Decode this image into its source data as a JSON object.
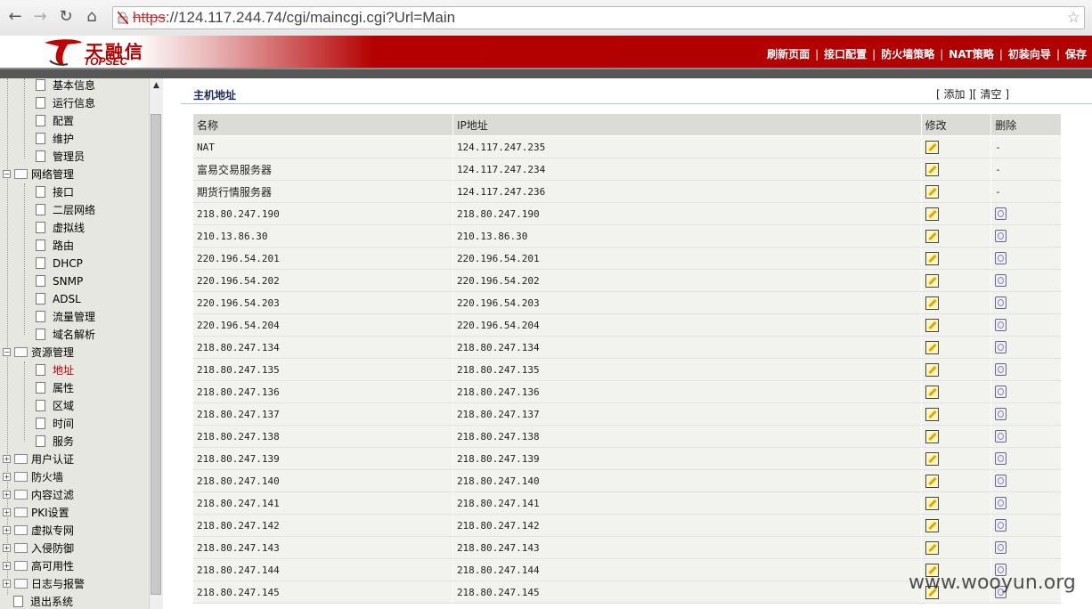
{
  "browser": {
    "url_scheme": "https",
    "url_host": "://124.117.244.74",
    "url_path": "/cgi/maincgi.cgi?Url=Main"
  },
  "header": {
    "logo_cn": "天融信",
    "logo_en": "TOPSEC",
    "menu": [
      "刷新页面",
      "接口配置",
      "防火墙策略",
      "NAT策略",
      "初装向导",
      "保存"
    ]
  },
  "sidebar": {
    "items": [
      {
        "label": "基本信息",
        "level": 2
      },
      {
        "label": "运行信息",
        "level": 2
      },
      {
        "label": "配置",
        "level": 2
      },
      {
        "label": "维护",
        "level": 2
      },
      {
        "label": "管理员",
        "level": 2
      },
      {
        "label": "网络管理",
        "level": 1,
        "state": "expanded"
      },
      {
        "label": "接口",
        "level": 2
      },
      {
        "label": "二层网络",
        "level": 2
      },
      {
        "label": "虚拟线",
        "level": 2
      },
      {
        "label": "路由",
        "level": 2
      },
      {
        "label": "DHCP",
        "level": 2
      },
      {
        "label": "SNMP",
        "level": 2
      },
      {
        "label": "ADSL",
        "level": 2
      },
      {
        "label": "流量管理",
        "level": 2
      },
      {
        "label": "域名解析",
        "level": 2
      },
      {
        "label": "资源管理",
        "level": 1,
        "state": "expanded"
      },
      {
        "label": "地址",
        "level": 2,
        "active": true
      },
      {
        "label": "属性",
        "level": 2
      },
      {
        "label": "区域",
        "level": 2
      },
      {
        "label": "时间",
        "level": 2
      },
      {
        "label": "服务",
        "level": 2
      },
      {
        "label": "用户认证",
        "level": 1,
        "state": "collapsed"
      },
      {
        "label": "防火墙",
        "level": 1,
        "state": "collapsed"
      },
      {
        "label": "内容过滤",
        "level": 1,
        "state": "collapsed"
      },
      {
        "label": "PKI设置",
        "level": 1,
        "state": "collapsed"
      },
      {
        "label": "虚拟专网",
        "level": 1,
        "state": "collapsed"
      },
      {
        "label": "入侵防御",
        "level": 1,
        "state": "collapsed"
      },
      {
        "label": "高可用性",
        "level": 1,
        "state": "collapsed"
      },
      {
        "label": "日志与报警",
        "level": 1,
        "state": "collapsed"
      },
      {
        "label": "退出系统",
        "level": 1,
        "state": "leaf"
      }
    ]
  },
  "main": {
    "title": "主机地址",
    "action_open": "[ ",
    "action_add": "添加",
    "action_mid": " ][ ",
    "action_clear": "清空",
    "action_close": " ]",
    "columns": [
      "名称",
      "IP地址",
      "修改",
      "删除"
    ],
    "rows": [
      {
        "name": "NAT",
        "ip": "124.117.247.235",
        "delete": "-"
      },
      {
        "name": "富易交易服务器",
        "ip": "124.117.247.234",
        "delete": "-"
      },
      {
        "name": "期货行情服务器",
        "ip": "124.117.247.236",
        "delete": "-"
      },
      {
        "name": "218.80.247.190",
        "ip": "218.80.247.190",
        "delete": "icon"
      },
      {
        "name": "210.13.86.30",
        "ip": "210.13.86.30",
        "delete": "icon"
      },
      {
        "name": "220.196.54.201",
        "ip": "220.196.54.201",
        "delete": "icon"
      },
      {
        "name": "220.196.54.202",
        "ip": "220.196.54.202",
        "delete": "icon"
      },
      {
        "name": "220.196.54.203",
        "ip": "220.196.54.203",
        "delete": "icon"
      },
      {
        "name": "220.196.54.204",
        "ip": "220.196.54.204",
        "delete": "icon"
      },
      {
        "name": "218.80.247.134",
        "ip": "218.80.247.134",
        "delete": "icon"
      },
      {
        "name": "218.80.247.135",
        "ip": "218.80.247.135",
        "delete": "icon"
      },
      {
        "name": "218.80.247.136",
        "ip": "218.80.247.136",
        "delete": "icon"
      },
      {
        "name": "218.80.247.137",
        "ip": "218.80.247.137",
        "delete": "icon"
      },
      {
        "name": "218.80.247.138",
        "ip": "218.80.247.138",
        "delete": "icon"
      },
      {
        "name": "218.80.247.139",
        "ip": "218.80.247.139",
        "delete": "icon"
      },
      {
        "name": "218.80.247.140",
        "ip": "218.80.247.140",
        "delete": "icon"
      },
      {
        "name": "218.80.247.141",
        "ip": "218.80.247.141",
        "delete": "icon"
      },
      {
        "name": "218.80.247.142",
        "ip": "218.80.247.142",
        "delete": "icon"
      },
      {
        "name": "218.80.247.143",
        "ip": "218.80.247.143",
        "delete": "icon"
      },
      {
        "name": "218.80.247.144",
        "ip": "218.80.247.144",
        "delete": "icon"
      },
      {
        "name": "218.80.247.145",
        "ip": "218.80.247.145",
        "delete": "icon"
      }
    ]
  },
  "watermark": "www.wooyun.org",
  "colors": {
    "brand_red": "#b40000",
    "active_item": "#c00000",
    "header_stripe": "#575757"
  }
}
